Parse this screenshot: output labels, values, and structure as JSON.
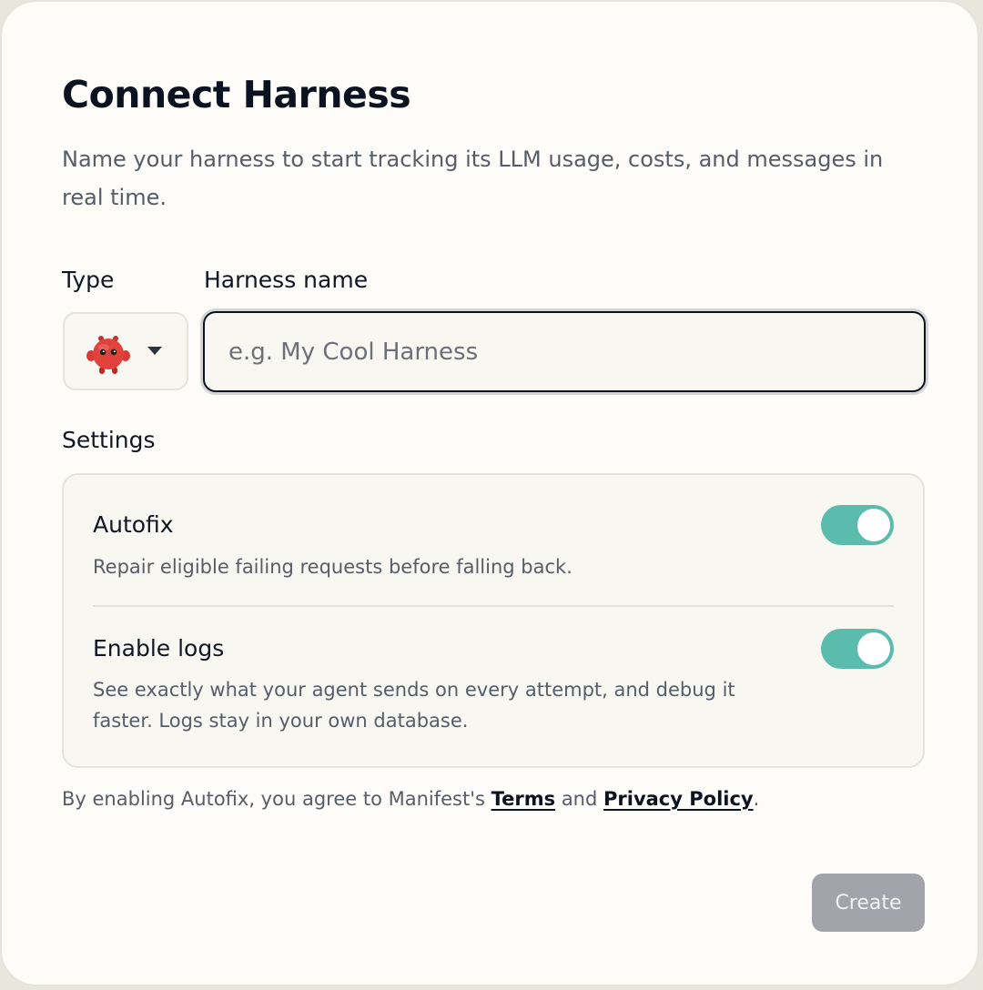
{
  "dialog": {
    "title": "Connect Harness",
    "subtitle": "Name your harness to start tracking its LLM usage, costs, and messages in real time."
  },
  "form": {
    "type_label": "Type",
    "type_icon": "red-mascot-icon",
    "name_label": "Harness name",
    "name_placeholder": "e.g. My Cool Harness",
    "name_value": ""
  },
  "settings": {
    "label": "Settings",
    "items": [
      {
        "title": "Autofix",
        "description": "Repair eligible failing requests before falling back.",
        "enabled": true
      },
      {
        "title": "Enable logs",
        "description": "See exactly what your agent sends on every attempt, and debug it faster. Logs stay in your own database.",
        "enabled": true
      }
    ]
  },
  "agreement": {
    "prefix": "By enabling Autofix, you agree to Manifest's ",
    "terms_link": "Terms",
    "middle": " and ",
    "privacy_link": "Privacy Policy",
    "suffix": "."
  },
  "actions": {
    "create_label": "Create"
  },
  "colors": {
    "toggle_on": "#5bbcae",
    "button_disabled": "#a1a4aa",
    "card_bg": "#fdfcf9"
  }
}
